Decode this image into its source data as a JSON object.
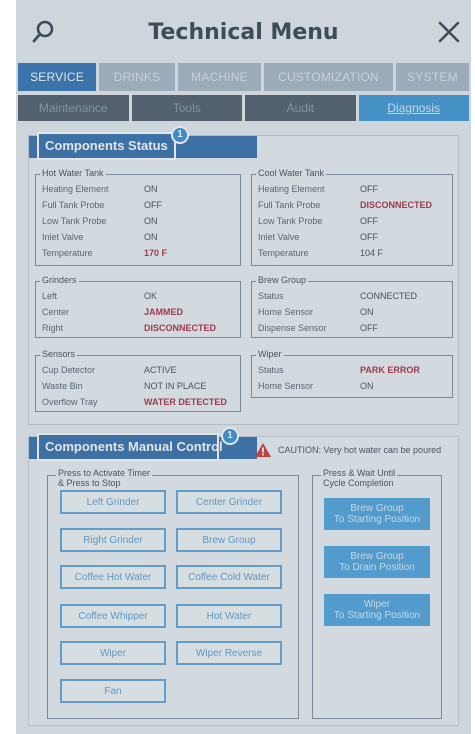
{
  "header": {
    "title": "Technical Menu",
    "search_icon": "search-icon",
    "close_icon": "close-icon"
  },
  "tabs": [
    {
      "label": "SERVICE",
      "active": true
    },
    {
      "label": "DRINKS",
      "active": false
    },
    {
      "label": "MACHINE",
      "active": false
    },
    {
      "label": "CUSTOMIZATION",
      "active": false
    },
    {
      "label": "SYSTEM",
      "active": false
    }
  ],
  "subtabs": [
    {
      "label": "Maintenance",
      "active": false
    },
    {
      "label": "Tools",
      "active": false
    },
    {
      "label": "Audit",
      "active": false
    },
    {
      "label": "Diagnosis",
      "active": true
    }
  ],
  "status": {
    "title": "Components Status",
    "badge": "1",
    "hot_water": {
      "legend": "Hot Water Tank",
      "rows": [
        {
          "k": "Heating Element",
          "v": "ON"
        },
        {
          "k": "Full Tank Probe",
          "v": "OFF"
        },
        {
          "k": "Low Tank Probe",
          "v": "ON"
        },
        {
          "k": "Inlet Valve",
          "v": "ON"
        },
        {
          "k": "Temperature",
          "v": "170 F"
        }
      ]
    },
    "cool_water": {
      "legend": "Cool Water Tank",
      "rows": [
        {
          "k": "Heating Element",
          "v": "OFF"
        },
        {
          "k": "Full Tank Probe",
          "v": "DISCONNECTED"
        },
        {
          "k": "Low Tank Probe",
          "v": "OFF"
        },
        {
          "k": "Inlet Valve",
          "v": "OFF"
        },
        {
          "k": "Temperature",
          "v": "104 F"
        }
      ]
    },
    "grinders": {
      "legend": "Grinders",
      "rows": [
        {
          "k": "Left",
          "v": "OK"
        },
        {
          "k": "Center",
          "v": "JAMMED"
        },
        {
          "k": "Right",
          "v": "DISCONNECTED"
        }
      ]
    },
    "brew_group": {
      "legend": "Brew Group",
      "rows": [
        {
          "k": "Status",
          "v": "CONNECTED"
        },
        {
          "k": "Home Sensor",
          "v": "ON"
        },
        {
          "k": "Dispense Sensor",
          "v": "OFF"
        }
      ]
    },
    "sensors": {
      "legend": "Sensors",
      "rows": [
        {
          "k": "Cup Detector",
          "v": "ACTIVE"
        },
        {
          "k": "Waste Bin",
          "v": "NOT IN PLACE"
        },
        {
          "k": "Overflow Tray",
          "v": "WATER DETECTED"
        }
      ]
    },
    "wiper": {
      "legend": "Wiper",
      "rows": [
        {
          "k": "Status",
          "v": "PARK ERROR"
        },
        {
          "k": "Home Sensor",
          "v": "ON"
        }
      ]
    }
  },
  "manual": {
    "title": "Components Manual Control",
    "badge": "1",
    "caution": "CAUTION: Very hot water can be poured",
    "press_legend_1": "Press to Activate Timer",
    "press_legend_2": "& Press to Stop",
    "wait_legend_1": "Press & Wait Until",
    "wait_legend_2": "Cycle Completion",
    "buttons": {
      "left_grinder": "Left Grinder",
      "center_grinder": "Center Grinder",
      "right_grinder": "Right Grinder",
      "brew_group": "Brew Group",
      "coffee_hot_water": "Coffee Hot Water",
      "coffee_cold_water": "Coffee Cold Water",
      "coffee_whipper": "Coffee Whipper",
      "hot_water": "Hot Water",
      "wiper": "Wiper",
      "wiper_reverse": "Wiper Reverse",
      "fan": "Fan"
    },
    "cycle": {
      "brew_start_1": "Brew Group",
      "brew_start_2": "To Starting Position",
      "brew_drain_1": "Brew Group",
      "brew_drain_2": "To Drain Position",
      "wiper_start_1": "Wiper",
      "wiper_start_2": "To Starting Position"
    }
  },
  "colors": {
    "accent": "#2a6fb0",
    "error": "#a8263d",
    "caution": "#d32f2f"
  }
}
